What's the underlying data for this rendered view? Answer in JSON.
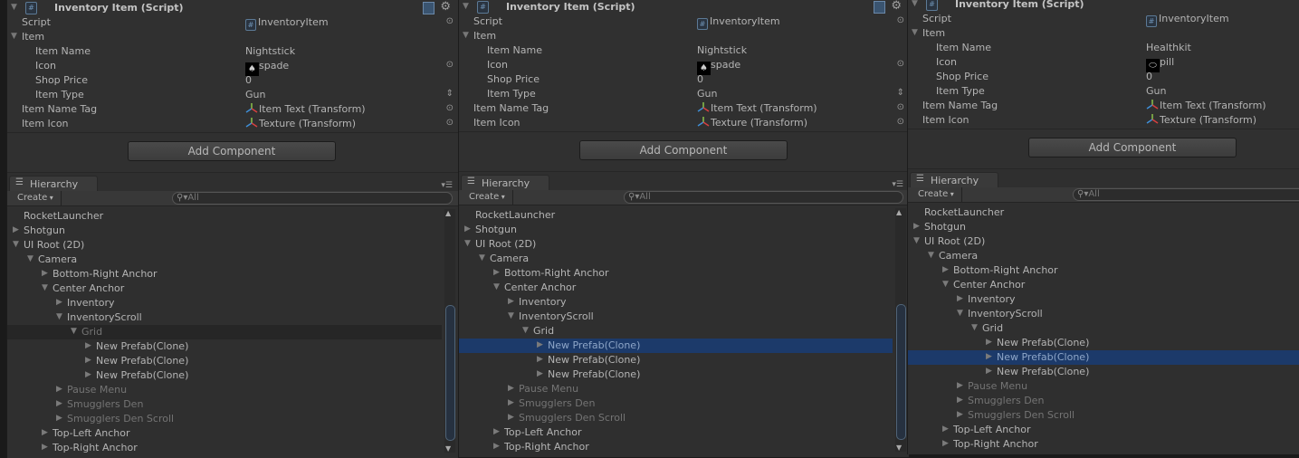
{
  "panels": [
    {
      "component_title": "Inventory Item (Script)",
      "properties": [
        {
          "label": "Script",
          "value": "InventoryItem",
          "indent": 0,
          "kind": "script",
          "picker": true
        },
        {
          "label": "Item",
          "value": "",
          "indent": 0,
          "kind": "foldout"
        },
        {
          "label": "Item Name",
          "value": "Nightstick",
          "indent": 1,
          "kind": "text"
        },
        {
          "label": "Icon",
          "value": "spade",
          "indent": 1,
          "kind": "texture",
          "picker": true
        },
        {
          "label": "Shop Price",
          "value": "0",
          "indent": 1,
          "kind": "text"
        },
        {
          "label": "Item Type",
          "value": "Gun",
          "indent": 1,
          "kind": "enum"
        },
        {
          "label": "Item Name Tag",
          "value": "Item Text (Transform)",
          "indent": 0,
          "kind": "transform",
          "picker": true
        },
        {
          "label": "Item Icon",
          "value": "Texture (Transform)",
          "indent": 0,
          "kind": "transform",
          "picker": true
        }
      ],
      "add_component": "Add Component",
      "hierarchy_tab": "Hierarchy",
      "create_label": "Create",
      "search_placeholder": "All",
      "selected_index": 8,
      "selection_style": "unfocused"
    },
    {
      "component_title": "Inventory Item (Script)",
      "properties": [
        {
          "label": "Script",
          "value": "InventoryItem",
          "indent": 0,
          "kind": "script",
          "picker": true
        },
        {
          "label": "Item",
          "value": "",
          "indent": 0,
          "kind": "foldout"
        },
        {
          "label": "Item Name",
          "value": "Nightstick",
          "indent": 1,
          "kind": "text"
        },
        {
          "label": "Icon",
          "value": "spade",
          "indent": 1,
          "kind": "texture",
          "picker": true
        },
        {
          "label": "Shop Price",
          "value": "0",
          "indent": 1,
          "kind": "text"
        },
        {
          "label": "Item Type",
          "value": "Gun",
          "indent": 1,
          "kind": "enum"
        },
        {
          "label": "Item Name Tag",
          "value": "Item Text (Transform)",
          "indent": 0,
          "kind": "transform",
          "picker": true
        },
        {
          "label": "Item Icon",
          "value": "Texture (Transform)",
          "indent": 0,
          "kind": "transform",
          "picker": true
        }
      ],
      "add_component": "Add Component",
      "hierarchy_tab": "Hierarchy",
      "create_label": "Create",
      "search_placeholder": "All",
      "selected_index": 9,
      "selection_style": "focused"
    },
    {
      "component_title": "Inventory Item (Script)",
      "properties": [
        {
          "label": "Script",
          "value": "InventoryItem",
          "indent": 0,
          "kind": "script",
          "picker": false
        },
        {
          "label": "Item",
          "value": "",
          "indent": 0,
          "kind": "foldout"
        },
        {
          "label": "Item Name",
          "value": "Healthkit",
          "indent": 1,
          "kind": "text"
        },
        {
          "label": "Icon",
          "value": "pill",
          "indent": 1,
          "kind": "texture",
          "picker": false
        },
        {
          "label": "Shop Price",
          "value": "0",
          "indent": 1,
          "kind": "text"
        },
        {
          "label": "Item Type",
          "value": "Gun",
          "indent": 1,
          "kind": "text"
        },
        {
          "label": "Item Name Tag",
          "value": "Item Text (Transform)",
          "indent": 0,
          "kind": "transform",
          "picker": false
        },
        {
          "label": "Item Icon",
          "value": "Texture (Transform)",
          "indent": 0,
          "kind": "transform",
          "picker": false
        }
      ],
      "add_component": "Add Component",
      "hierarchy_tab": "Hierarchy",
      "create_label": "Create",
      "search_placeholder": "All",
      "selected_index": 10,
      "selection_style": "focused"
    }
  ],
  "hierarchy": [
    {
      "name": "RocketLauncher",
      "level": 0,
      "arrow": "none",
      "inactive": false
    },
    {
      "name": "Shotgun",
      "level": 0,
      "arrow": "right",
      "inactive": false
    },
    {
      "name": "UI Root (2D)",
      "level": 0,
      "arrow": "down",
      "inactive": false
    },
    {
      "name": "Camera",
      "level": 1,
      "arrow": "down",
      "inactive": false
    },
    {
      "name": "Bottom-Right Anchor",
      "level": 2,
      "arrow": "right",
      "inactive": false
    },
    {
      "name": "Center Anchor",
      "level": 2,
      "arrow": "down",
      "inactive": false
    },
    {
      "name": "Inventory",
      "level": 3,
      "arrow": "right",
      "inactive": false
    },
    {
      "name": "InventoryScroll",
      "level": 3,
      "arrow": "down",
      "inactive": false
    },
    {
      "name": "Grid",
      "level": 4,
      "arrow": "down",
      "inactive": false
    },
    {
      "name": "New Prefab(Clone)",
      "level": 5,
      "arrow": "right",
      "inactive": false
    },
    {
      "name": "New Prefab(Clone)",
      "level": 5,
      "arrow": "right",
      "inactive": false
    },
    {
      "name": "New Prefab(Clone)",
      "level": 5,
      "arrow": "right",
      "inactive": false
    },
    {
      "name": "Pause Menu",
      "level": 3,
      "arrow": "right",
      "inactive": true
    },
    {
      "name": "Smugglers Den",
      "level": 3,
      "arrow": "right",
      "inactive": true
    },
    {
      "name": "Smugglers Den Scroll",
      "level": 3,
      "arrow": "right",
      "inactive": true
    },
    {
      "name": "Top-Left Anchor",
      "level": 2,
      "arrow": "right",
      "inactive": false
    },
    {
      "name": "Top-Right Anchor",
      "level": 2,
      "arrow": "right",
      "inactive": false
    }
  ],
  "colors": {
    "selection_focused": "#1c3a6a",
    "selection_unfocused": "#262626",
    "background": "#2f2f2f"
  },
  "icons": {
    "component": "csharp-script-icon",
    "help": "help-book-icon",
    "settings": "gear-icon",
    "transform": "transform-axis-icon",
    "object_picker": "target-icon"
  }
}
